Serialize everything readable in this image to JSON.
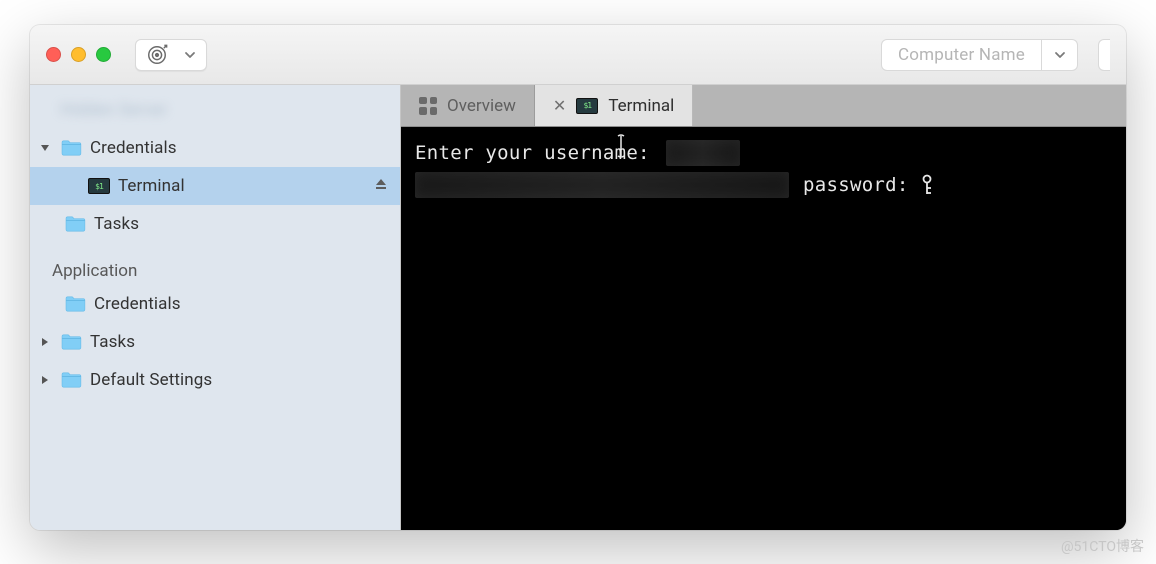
{
  "titlebar": {
    "device_name_placeholder": "Computer Name"
  },
  "sidebar": {
    "item_hidden_label": "Hidden Server",
    "credentials": {
      "label": "Credentials",
      "terminal_label": "Terminal",
      "tasks_label": "Tasks"
    },
    "application": {
      "section_label": "Application",
      "credentials_label": "Credentials",
      "tasks_label": "Tasks",
      "default_settings_label": "Default Settings"
    }
  },
  "tabs": {
    "overview_label": "Overview",
    "terminal_label": "Terminal"
  },
  "terminal": {
    "line1_prefix": "Enter your userna",
    "line1_mid": "m",
    "line1_suffix": "e:",
    "line2_password_label": "password:"
  },
  "watermark": "@51CTO博客"
}
